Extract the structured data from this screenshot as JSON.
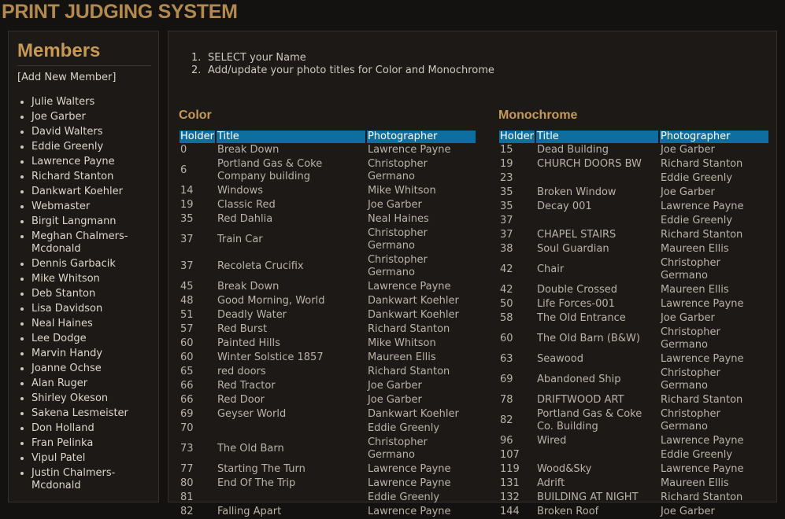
{
  "app": {
    "title": "PRINT JUDGING SYSTEM"
  },
  "sidebar": {
    "heading": "Members",
    "add_member": "[Add New Member]",
    "members": [
      "Julie Walters",
      "Joe Garber",
      "David Walters",
      "Eddie Greenly",
      "Lawrence Payne",
      "Richard Stanton",
      "Dankwart Koehler",
      "Webmaster",
      "Birgit Langmann",
      "Meghan Chalmers-Mcdonald",
      "Dennis Garbacik",
      "Mike Whitson",
      "Deb Stanton",
      "Lisa Davidson",
      "Neal Haines",
      "Lee Dodge",
      "Marvin Handy",
      "Joanne Ochse",
      "Alan Ruger",
      "Shirley Okeson",
      "Sakena Lesmeister",
      "Don Holland",
      "Fran Pelinka",
      "Vipul Patel",
      "Justin Chalmers-Mcdonald"
    ]
  },
  "instructions": {
    "step1_num": "1.",
    "step1": "SELECT your Name",
    "step2_num": "2.",
    "step2": "Add/update your photo titles for Color and Monochrome"
  },
  "columns": {
    "holder": "Holder",
    "title": "Title",
    "photographer": "Photographer"
  },
  "color": {
    "heading": "Color",
    "rows": [
      {
        "holder": "0",
        "title": "Break Down",
        "photographer": "Lawrence Payne"
      },
      {
        "holder": "6",
        "title": "Portland Gas & Coke Company building",
        "photographer": "Christopher Germano"
      },
      {
        "holder": "14",
        "title": "Windows",
        "photographer": "Mike Whitson"
      },
      {
        "holder": "19",
        "title": "Classic Red",
        "photographer": "Joe Garber"
      },
      {
        "holder": "35",
        "title": "Red Dahlia",
        "photographer": "Neal Haines"
      },
      {
        "holder": "37",
        "title": "Train Car",
        "photographer": "Christopher Germano"
      },
      {
        "holder": "37",
        "title": "Recoleta Crucifix",
        "photographer": "Christopher Germano"
      },
      {
        "holder": "45",
        "title": "Break Down",
        "photographer": "Lawrence Payne"
      },
      {
        "holder": "48",
        "title": "Good Morning, World",
        "photographer": "Dankwart Koehler"
      },
      {
        "holder": "51",
        "title": "Deadly Water",
        "photographer": "Dankwart Koehler"
      },
      {
        "holder": "57",
        "title": "Red Burst",
        "photographer": "Richard Stanton"
      },
      {
        "holder": "60",
        "title": "Painted Hills",
        "photographer": "Mike Whitson"
      },
      {
        "holder": "60",
        "title": "Winter Solstice 1857",
        "photographer": "Maureen Ellis"
      },
      {
        "holder": "65",
        "title": "red doors",
        "photographer": "Richard Stanton"
      },
      {
        "holder": "66",
        "title": "Red Tractor",
        "photographer": "Joe Garber"
      },
      {
        "holder": "66",
        "title": "Red Door",
        "photographer": "Joe Garber"
      },
      {
        "holder": "69",
        "title": "Geyser World",
        "photographer": "Dankwart Koehler"
      },
      {
        "holder": "70",
        "title": "",
        "photographer": "Eddie Greenly"
      },
      {
        "holder": "73",
        "title": "The Old Barn",
        "photographer": "Christopher Germano"
      },
      {
        "holder": "77",
        "title": "Starting The Turn",
        "photographer": "Lawrence Payne"
      },
      {
        "holder": "80",
        "title": "End Of The Trip",
        "photographer": "Lawrence Payne"
      },
      {
        "holder": "81",
        "title": "",
        "photographer": "Eddie Greenly"
      },
      {
        "holder": "82",
        "title": "Falling Apart",
        "photographer": "Lawrence Payne"
      }
    ]
  },
  "mono": {
    "heading": "Monochrome",
    "rows": [
      {
        "holder": "15",
        "title": "Dead Building",
        "photographer": "Joe Garber"
      },
      {
        "holder": "19",
        "title": "CHURCH DOORS BW",
        "photographer": "Richard Stanton"
      },
      {
        "holder": "23",
        "title": "",
        "photographer": "Eddie Greenly"
      },
      {
        "holder": "35",
        "title": "Broken Window",
        "photographer": "Joe Garber"
      },
      {
        "holder": "35",
        "title": "Decay 001",
        "photographer": "Lawrence Payne"
      },
      {
        "holder": "37",
        "title": "",
        "photographer": "Eddie Greenly"
      },
      {
        "holder": "37",
        "title": "CHAPEL STAIRS",
        "photographer": "Richard Stanton"
      },
      {
        "holder": "38",
        "title": "Soul Guardian",
        "photographer": "Maureen Ellis"
      },
      {
        "holder": "42",
        "title": "Chair",
        "photographer": "Christopher Germano"
      },
      {
        "holder": "42",
        "title": "Double Crossed",
        "photographer": "Maureen Ellis"
      },
      {
        "holder": "50",
        "title": "Life Forces-001",
        "photographer": "Lawrence Payne"
      },
      {
        "holder": "58",
        "title": "The Old Entrance",
        "photographer": "Joe Garber"
      },
      {
        "holder": "60",
        "title": "The Old Barn (B&W)",
        "photographer": "Christopher Germano"
      },
      {
        "holder": "63",
        "title": "Seawood",
        "photographer": "Lawrence Payne"
      },
      {
        "holder": "69",
        "title": "Abandoned Ship",
        "photographer": "Christopher Germano"
      },
      {
        "holder": "78",
        "title": "DRIFTWOOD ART",
        "photographer": "Richard Stanton"
      },
      {
        "holder": "82",
        "title": "Portland Gas & Coke Co. Building",
        "photographer": "Christopher Germano"
      },
      {
        "holder": "96",
        "title": "Wired",
        "photographer": "Lawrence Payne"
      },
      {
        "holder": "107",
        "title": "",
        "photographer": "Eddie Greenly"
      },
      {
        "holder": "119",
        "title": "Wood&Sky",
        "photographer": "Lawrence Payne"
      },
      {
        "holder": "131",
        "title": "Adrift",
        "photographer": "Maureen Ellis"
      },
      {
        "holder": "132",
        "title": "BUILDING AT NIGHT",
        "photographer": "Richard Stanton"
      },
      {
        "holder": "144",
        "title": "Broken Roof",
        "photographer": "Joe Garber"
      }
    ]
  }
}
